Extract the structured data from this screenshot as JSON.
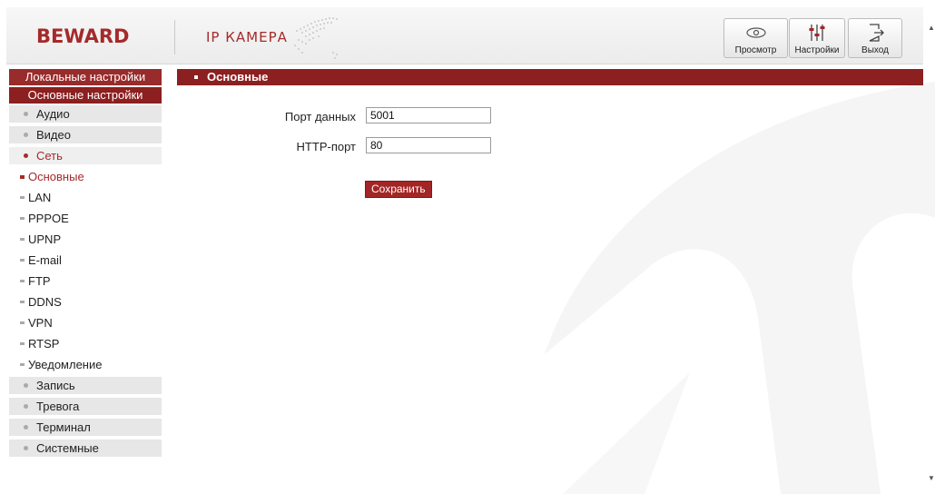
{
  "header": {
    "logo": "BEWARD",
    "title": "IP КАМЕРА",
    "buttons": {
      "view": "Просмотр",
      "settings": "Настройки",
      "exit": "Выход"
    }
  },
  "sidebar": {
    "local_settings": "Локальные настройки",
    "basic_settings": "Основные настройки",
    "top_items": [
      {
        "label": "Аудио"
      },
      {
        "label": "Видео"
      },
      {
        "label": "Сеть"
      }
    ],
    "sub_items": [
      {
        "label": "Основные"
      },
      {
        "label": "LAN"
      },
      {
        "label": "PPPOE"
      },
      {
        "label": "UPNP"
      },
      {
        "label": "E-mail"
      },
      {
        "label": "FTP"
      },
      {
        "label": "DDNS"
      },
      {
        "label": "VPN"
      },
      {
        "label": "RTSP"
      },
      {
        "label": "Уведомление"
      }
    ],
    "bottom_items": [
      {
        "label": "Запись"
      },
      {
        "label": "Тревога"
      },
      {
        "label": "Терминал"
      },
      {
        "label": "Системные"
      }
    ]
  },
  "main": {
    "section_title": "Основные",
    "data_port_label": "Порт данных",
    "data_port_value": "5001",
    "http_port_label": "HTTP-порт",
    "http_port_value": "80",
    "save_label": "Сохранить"
  },
  "colors": {
    "accent": "#8c1f1f",
    "active_text": "#a52a2a"
  }
}
